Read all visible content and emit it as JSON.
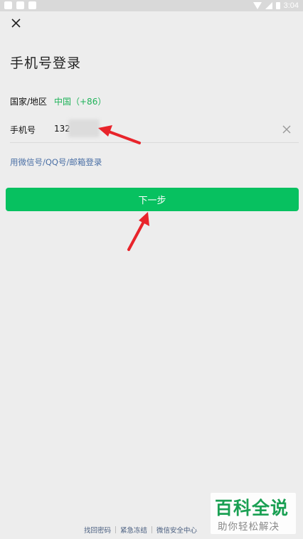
{
  "status_bar": {
    "time": "3:04",
    "icons": [
      "notification-icon",
      "gallery-icon",
      "app-notification-icon",
      "wifi-icon",
      "signal-icon",
      "battery-icon"
    ]
  },
  "header": {
    "close_icon": "close-icon",
    "title": "手机号登录"
  },
  "form": {
    "country_label": "国家/地区",
    "country_value": "中国（+86）",
    "phone_label": "手机号",
    "phone_value": "132",
    "clear_icon": "clear-icon"
  },
  "alt_login": "用微信号/QQ号/邮箱登录",
  "next_button": "下一步",
  "footer": {
    "links": [
      "找回密码",
      "紧急冻结",
      "微信安全中心"
    ]
  },
  "watermark": {
    "main": "百科全说",
    "sub": "助你轻松解决"
  },
  "colors": {
    "accent": "#07c160",
    "link": "#4a6fa5",
    "background": "#ededed",
    "annotation_arrow": "#e8242b"
  }
}
